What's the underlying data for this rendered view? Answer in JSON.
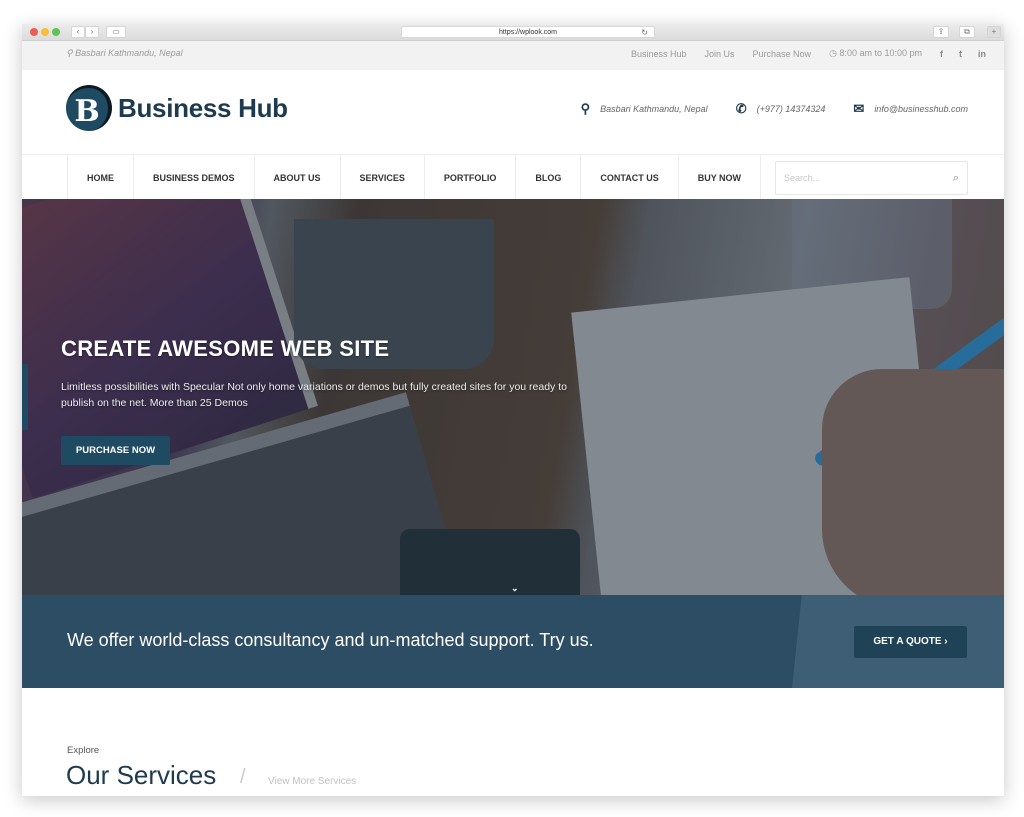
{
  "browser": {
    "url": "https://wplook.com",
    "back_icon": "‹",
    "forward_icon": "›",
    "sidebar_icon": "▭",
    "reload_icon": "↻",
    "share_icon": "⇪",
    "tabs_icon": "⧉",
    "new_tab_icon": "+"
  },
  "topbar": {
    "location_icon": "⚲",
    "location": "Basbari Kathmandu, Nepal",
    "links": [
      "Business Hub",
      "Join Us",
      "Purchase Now"
    ],
    "clock_icon": "◷",
    "hours": "8:00 am to 10:00 pm",
    "social": {
      "facebook": "f",
      "twitter": "t",
      "linkedin": "in"
    }
  },
  "header": {
    "logo_letter": "B",
    "logo_text": "Business Hub",
    "address_icon": "⚲",
    "address": "Basbari Kathmandu, Nepal",
    "phone_icon": "✆",
    "phone": "(+977) 14374324",
    "email_icon": "✉",
    "email": "info@businesshub.com"
  },
  "nav": {
    "items": [
      "HOME",
      "BUSINESS DEMOS",
      "ABOUT US",
      "SERVICES",
      "PORTFOLIO",
      "BLOG",
      "CONTACT US",
      "BUY NOW"
    ],
    "search_placeholder": "Search...",
    "search_icon": "⌕"
  },
  "hero": {
    "title": "CREATE AWESOME WEB SITE",
    "text": "Limitless possibilities with Specular Not only home variations or demos but fully created sites for you ready to publish on the net. More than 25 Demos",
    "button": "PURCHASE NOW",
    "scroll_icon": "⌄"
  },
  "cta": {
    "text": "We offer world-class consultancy and un-matched support. Try us.",
    "button": "GET A QUOTE ›"
  },
  "services": {
    "eyebrow": "Explore",
    "title": "Our Services",
    "separator": "/",
    "link": "View More Services"
  },
  "colors": {
    "brand": "#1e4a62",
    "cta_band": "#2c4d64",
    "heading": "#1e3a4e"
  }
}
